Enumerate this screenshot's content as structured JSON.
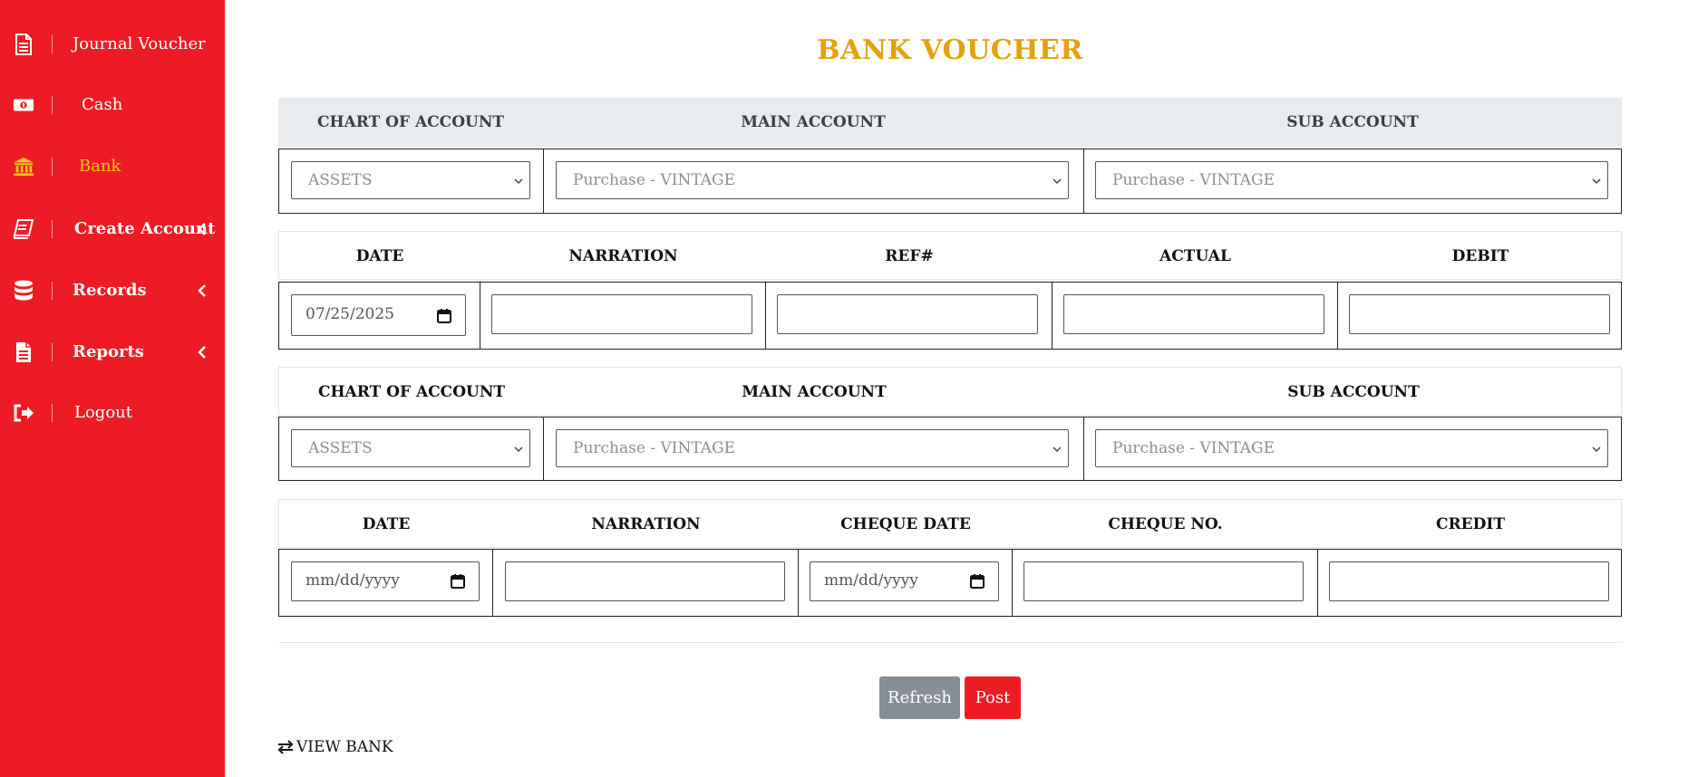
{
  "sidebar": {
    "items": [
      {
        "label": "Journal Voucher",
        "icon": "document-icon",
        "active": false,
        "has_chevron": false
      },
      {
        "label": "Cash",
        "icon": "money-icon",
        "active": false,
        "has_chevron": false
      },
      {
        "label": "Bank",
        "icon": "bank-icon",
        "active": true,
        "has_chevron": false
      },
      {
        "label": "Create Account",
        "icon": "book-icon",
        "active": false,
        "has_chevron": true
      },
      {
        "label": "Records",
        "icon": "database-icon",
        "active": false,
        "has_chevron": true
      },
      {
        "label": "Reports",
        "icon": "report-icon",
        "active": false,
        "has_chevron": true
      },
      {
        "label": "Logout",
        "icon": "logout-icon",
        "active": false,
        "has_chevron": false
      }
    ]
  },
  "page": {
    "title": "BANK VOUCHER"
  },
  "debit_accounts": {
    "headers": [
      "CHART OF ACCOUNT",
      "MAIN ACCOUNT",
      "SUB ACCOUNT"
    ],
    "chart_of_account": "ASSETS",
    "main_account": "Purchase - VINTAGE",
    "sub_account": "Purchase - VINTAGE"
  },
  "debit_entry": {
    "headers": [
      "DATE",
      "NARRATION",
      "REF#",
      "ACTUAL",
      "DEBIT"
    ],
    "date": "07/25/2025",
    "narration": "",
    "ref": "",
    "actual": "",
    "debit": ""
  },
  "credit_accounts": {
    "headers": [
      "CHART OF ACCOUNT",
      "MAIN ACCOUNT",
      "SUB ACCOUNT"
    ],
    "chart_of_account": "ASSETS",
    "main_account": "Purchase - VINTAGE",
    "sub_account": "Purchase - VINTAGE"
  },
  "credit_entry": {
    "headers": [
      "DATE",
      "NARRATION",
      "CHEQUE DATE",
      "CHEQUE NO.",
      "CREDIT"
    ],
    "date_placeholder": "mm/dd/yyyy",
    "narration": "",
    "cheque_date_placeholder": "mm/dd/yyyy",
    "cheque_no": "",
    "credit": ""
  },
  "actions": {
    "refresh_label": "Refresh",
    "post_label": "Post"
  },
  "footer": {
    "view_link": "VIEW BANK"
  },
  "colors": {
    "sidebar_bg": "#ed1c24",
    "active_item": "#f5c518",
    "title": "#e2a20c",
    "header_gray": "#e9ecef",
    "refresh_btn": "#868e96",
    "post_btn": "#ed1c24"
  }
}
